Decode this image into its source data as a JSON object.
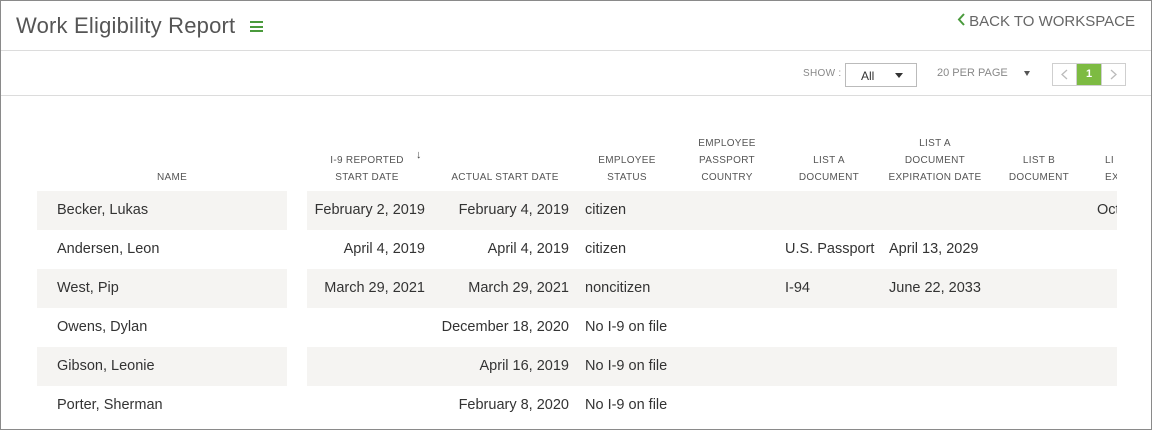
{
  "header": {
    "title": "Work Eligibility Report",
    "back_label": "BACK TO WORKSPACE"
  },
  "toolbar": {
    "show_label": "SHOW :",
    "show_value": "All",
    "per_page": "20 PER PAGE",
    "current_page": "1"
  },
  "table": {
    "columns": {
      "name": "NAME",
      "reported_1": "I-9 REPORTED",
      "reported_2": "START DATE",
      "actual": "ACTUAL START DATE",
      "status_1": "EMPLOYEE",
      "status_2": "STATUS",
      "passport_1": "EMPLOYEE",
      "passport_2": "PASSPORT",
      "passport_3": "COUNTRY",
      "lista_1": "LIST A",
      "lista_2": "DOCUMENT",
      "listaexp_1": "LIST A",
      "listaexp_2": "DOCUMENT",
      "listaexp_3": "EXPIRATION DATE",
      "listb_1": "LIST B",
      "listb_2": "DOCUMENT",
      "listc_1": "LI",
      "listc_2": "EX"
    },
    "rows": [
      {
        "name": "Becker, Lukas",
        "reported": "February 2, 2019",
        "actual": "February 4, 2019",
        "status": "citizen",
        "lista": "",
        "listaexp": "",
        "extra": "Oct"
      },
      {
        "name": "Andersen, Leon",
        "reported": "April 4, 2019",
        "actual": "April 4, 2019",
        "status": "citizen",
        "lista": "U.S. Passport",
        "listaexp": "April 13, 2029",
        "extra": ""
      },
      {
        "name": "West, Pip",
        "reported": "March 29, 2021",
        "actual": "March 29, 2021",
        "status": "noncitizen",
        "lista": "I-94",
        "listaexp": "June 22, 2033",
        "extra": ""
      },
      {
        "name": "Owens, Dylan",
        "reported": "",
        "actual": "December 18, 2020",
        "status": "No I-9 on file",
        "lista": "",
        "listaexp": "",
        "extra": ""
      },
      {
        "name": "Gibson, Leonie",
        "reported": "",
        "actual": "April 16, 2019",
        "status": "No I-9 on file",
        "lista": "",
        "listaexp": "",
        "extra": ""
      },
      {
        "name": "Porter, Sherman",
        "reported": "",
        "actual": "February 8, 2020",
        "status": "No I-9 on file",
        "lista": "",
        "listaexp": "",
        "extra": ""
      }
    ]
  },
  "colors": {
    "accent": "#7dbb42",
    "icon_green": "#4a9a3c",
    "stripe": "#f5f4f2"
  }
}
